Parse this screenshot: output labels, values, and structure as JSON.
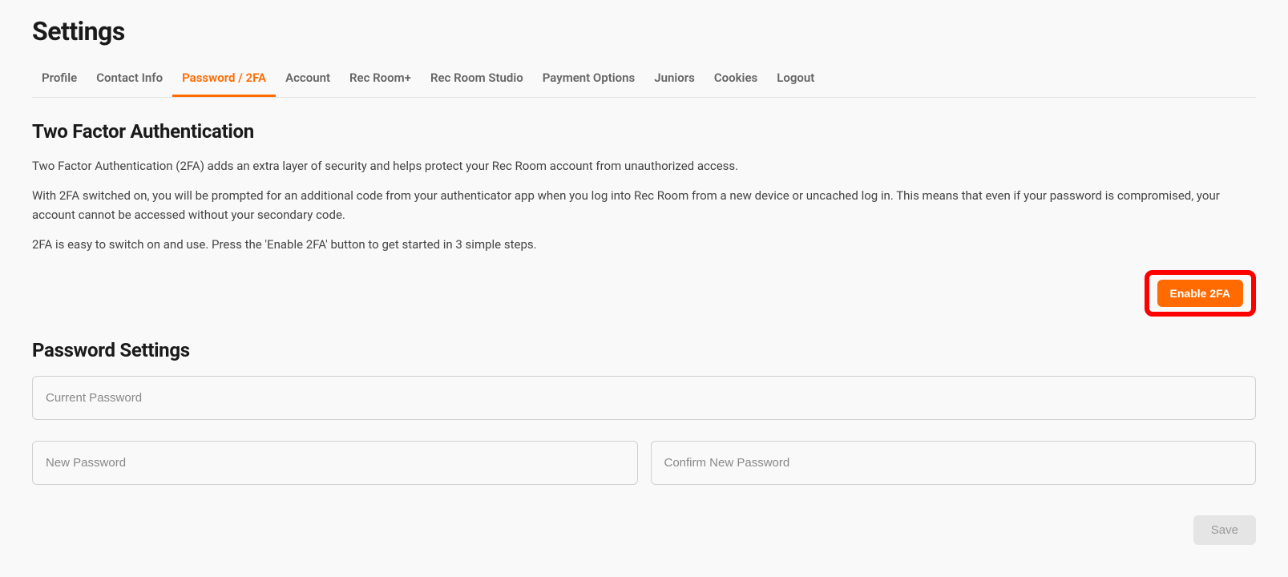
{
  "page_title": "Settings",
  "tabs": [
    {
      "label": "Profile",
      "active": false
    },
    {
      "label": "Contact Info",
      "active": false
    },
    {
      "label": "Password / 2FA",
      "active": true
    },
    {
      "label": "Account",
      "active": false
    },
    {
      "label": "Rec Room+",
      "active": false
    },
    {
      "label": "Rec Room Studio",
      "active": false
    },
    {
      "label": "Payment Options",
      "active": false
    },
    {
      "label": "Juniors",
      "active": false
    },
    {
      "label": "Cookies",
      "active": false
    },
    {
      "label": "Logout",
      "active": false
    }
  ],
  "two_fa": {
    "heading": "Two Factor Authentication",
    "p1": "Two Factor Authentication (2FA) adds an extra layer of security and helps protect your Rec Room account from unauthorized access.",
    "p2": "With 2FA switched on, you will be prompted for an additional code from your authenticator app when you log into Rec Room from a new device or uncached log in. This means that even if your password is compromised, your account cannot be accessed without your secondary code.",
    "p3": "2FA is easy to switch on and use. Press the 'Enable 2FA' button to get started in 3 simple steps.",
    "enable_button": "Enable 2FA"
  },
  "password": {
    "heading": "Password Settings",
    "current_placeholder": "Current Password",
    "new_placeholder": "New Password",
    "confirm_placeholder": "Confirm New Password",
    "save_button": "Save"
  }
}
